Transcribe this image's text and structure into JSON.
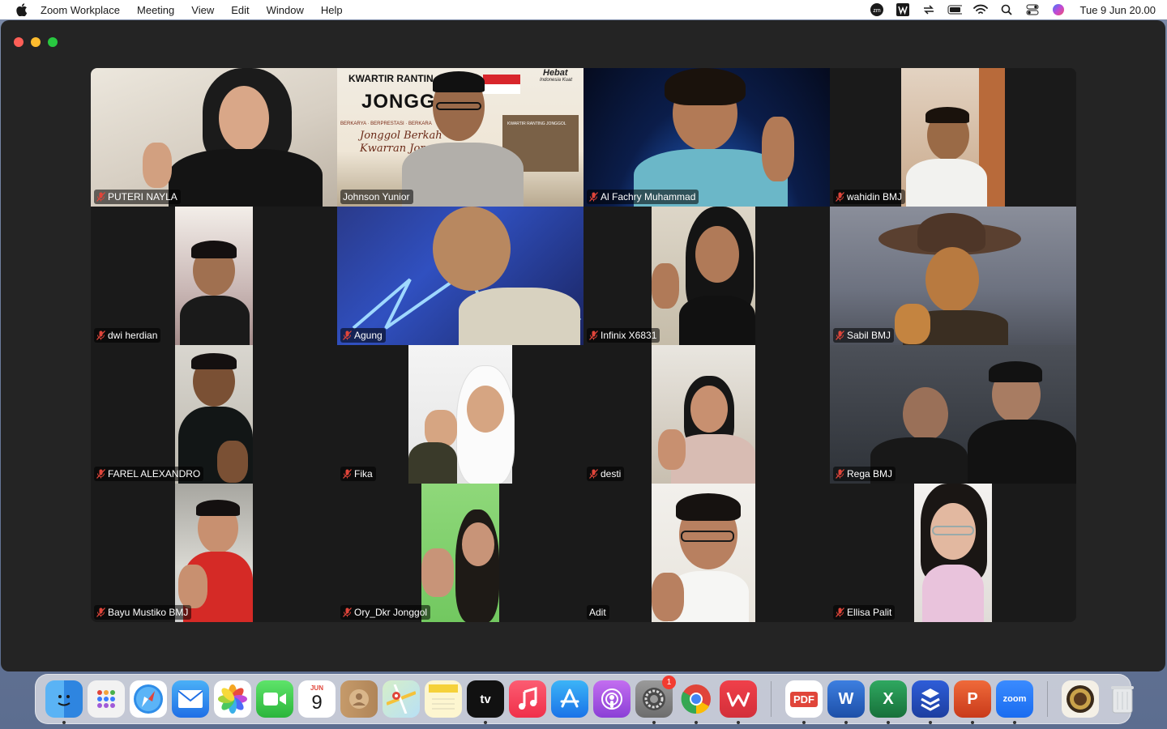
{
  "menubar": {
    "app_name": "Zoom Workplace",
    "items": [
      "Meeting",
      "View",
      "Edit",
      "Window",
      "Help"
    ],
    "clock": "Tue 9 Jun  20.00",
    "status_icons": [
      "zoom-status-icon",
      "wps-icon",
      "sync-icon",
      "battery-icon",
      "wifi-icon",
      "spotlight-search-icon",
      "control-center-icon",
      "siri-icon"
    ]
  },
  "participants": [
    {
      "name": "PUTERI NAYLA",
      "muted": true
    },
    {
      "name": "Johnson Yunior",
      "muted": false,
      "active_speaker": true
    },
    {
      "name": "Al Fachry Muhammad",
      "muted": true
    },
    {
      "name": "wahidin BMJ",
      "muted": true
    },
    {
      "name": "dwi herdian",
      "muted": true
    },
    {
      "name": "Agung",
      "muted": true
    },
    {
      "name": "Infinix X6831",
      "muted": true
    },
    {
      "name": "Sabil BMJ",
      "muted": true
    },
    {
      "name": "FAREL ALEXANDRO",
      "muted": true
    },
    {
      "name": "Fika",
      "muted": true
    },
    {
      "name": "desti",
      "muted": true
    },
    {
      "name": "Rega BMJ",
      "muted": true
    },
    {
      "name": "Bayu Mustiko BMJ",
      "muted": true
    },
    {
      "name": "Ory_Dkr Jonggol",
      "muted": true
    },
    {
      "name": "Adit",
      "muted": false
    },
    {
      "name": "Ellisa Palit",
      "muted": true
    }
  ],
  "background_overlay": {
    "line1": "KWARTIR RANTIN",
    "line2": "JONGGO",
    "tagline": "BERKARYA · BERPRESTASI · BERKARA",
    "script": "Jonggol Berkah",
    "script2": "Kwarran Jonggol S",
    "badge": "Hebat",
    "badge_sub": "Indonesia Kuat",
    "building": "KWARTIR RANTING JONGGOL"
  },
  "dock": {
    "calendar_month": "JUN",
    "calendar_day": "9",
    "settings_badge": "1",
    "tv_label": "tv",
    "pdf_label": "PDF",
    "word_label": "W",
    "excel_label": "X",
    "ppt_label": "P",
    "zoom_label": "zoom"
  },
  "colors": {
    "active_speaker_border": "#2fd058",
    "mute_red": "#e0453a",
    "window_bg": "#242424"
  }
}
